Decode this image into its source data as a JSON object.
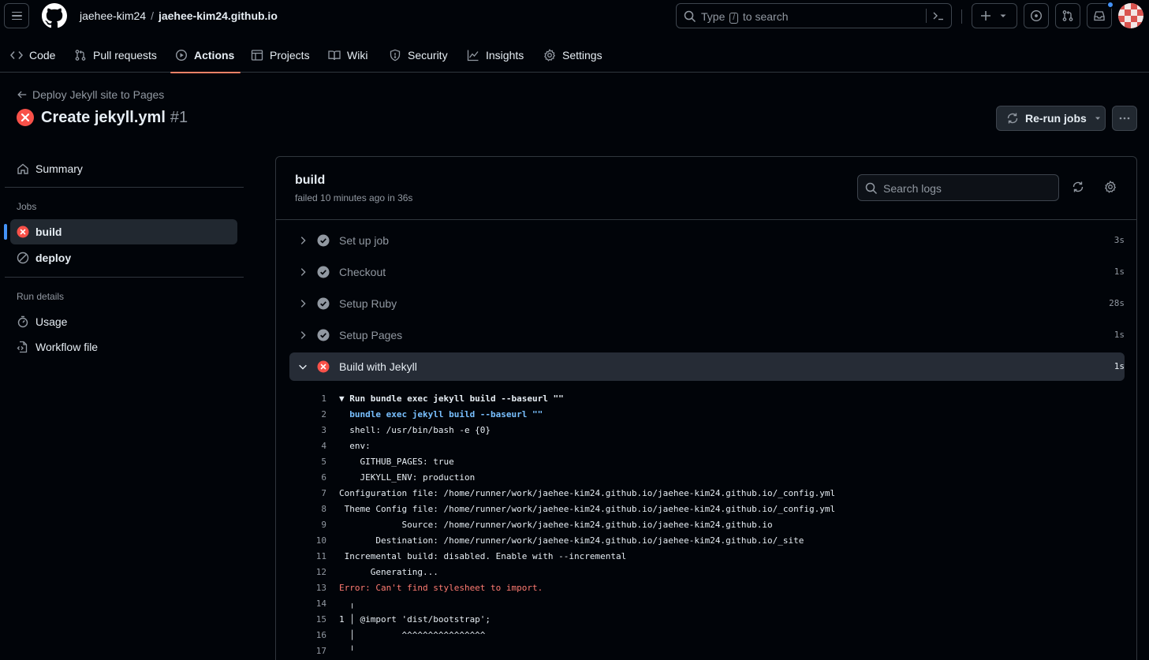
{
  "header": {
    "owner": "jaehee-kim24",
    "separator": "/",
    "repo": "jaehee-kim24.github.io",
    "search": {
      "prefix": "Type",
      "key": "/",
      "suffix": "to search"
    }
  },
  "nav": {
    "code": "Code",
    "pull_requests": "Pull requests",
    "actions": "Actions",
    "projects": "Projects",
    "wiki": "Wiki",
    "security": "Security",
    "insights": "Insights",
    "settings": "Settings"
  },
  "run": {
    "back_label": "Deploy Jekyll site to Pages",
    "title": "Create jekyll.yml",
    "number": "#1",
    "rerun_label": "Re-run jobs"
  },
  "sidebar": {
    "summary": "Summary",
    "jobs_heading": "Jobs",
    "jobs": [
      {
        "label": "build",
        "status": "failed"
      },
      {
        "label": "deploy",
        "status": "skipped"
      }
    ],
    "run_details_heading": "Run details",
    "usage": "Usage",
    "workflow_file": "Workflow file"
  },
  "job": {
    "name": "build",
    "status_text": "failed 10 minutes ago in 36s",
    "search_placeholder": "Search logs"
  },
  "steps": [
    {
      "label": "Set up job",
      "duration": "3s",
      "status": "success"
    },
    {
      "label": "Checkout",
      "duration": "1s",
      "status": "success"
    },
    {
      "label": "Setup Ruby",
      "duration": "28s",
      "status": "success"
    },
    {
      "label": "Setup Pages",
      "duration": "1s",
      "status": "success"
    },
    {
      "label": "Build with Jekyll",
      "duration": "1s",
      "status": "failed"
    }
  ],
  "log_lines": [
    {
      "n": "1",
      "text": "▼ Run bundle exec jekyll build --baseurl \"\""
    },
    {
      "n": "2",
      "text": "  bundle exec jekyll build --baseurl \"\""
    },
    {
      "n": "3",
      "text": "  shell: /usr/bin/bash -e {0}"
    },
    {
      "n": "4",
      "text": "  env:"
    },
    {
      "n": "5",
      "text": "    GITHUB_PAGES: true"
    },
    {
      "n": "6",
      "text": "    JEKYLL_ENV: production"
    },
    {
      "n": "7",
      "text": "Configuration file: /home/runner/work/jaehee-kim24.github.io/jaehee-kim24.github.io/_config.yml"
    },
    {
      "n": "8",
      "text": " Theme Config file: /home/runner/work/jaehee-kim24.github.io/jaehee-kim24.github.io/_config.yml"
    },
    {
      "n": "9",
      "text": "            Source: /home/runner/work/jaehee-kim24.github.io/jaehee-kim24.github.io"
    },
    {
      "n": "10",
      "text": "       Destination: /home/runner/work/jaehee-kim24.github.io/jaehee-kim24.github.io/_site"
    },
    {
      "n": "11",
      "text": " Incremental build: disabled. Enable with --incremental"
    },
    {
      "n": "12",
      "text": "      Generating..."
    },
    {
      "n": "13",
      "text": "Error: Can't find stylesheet to import."
    },
    {
      "n": "14",
      "text": "  ╷"
    },
    {
      "n": "15",
      "text": "1 │ @import 'dist/bootstrap';"
    },
    {
      "n": "16",
      "text": "  │         ^^^^^^^^^^^^^^^^"
    },
    {
      "n": "17",
      "text": "  ╵"
    }
  ]
}
